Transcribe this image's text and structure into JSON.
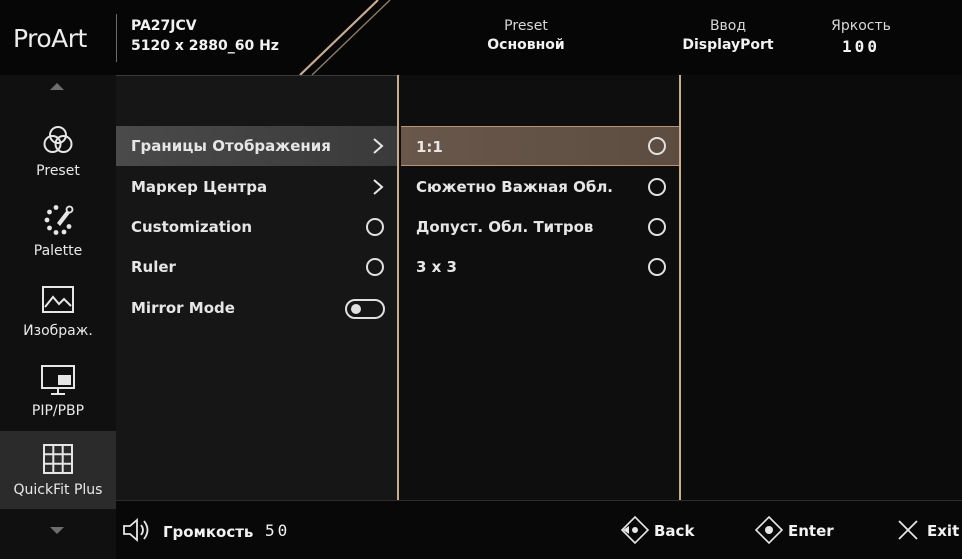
{
  "header": {
    "logo": "ProArt",
    "model": "PA27JCV",
    "resolution": "5120 x 2880_60 Hz",
    "preset_label": "Preset",
    "preset_value": "Основной",
    "input_label": "Ввод",
    "input_value": "DisplayPort",
    "brightness_label": "Яркость",
    "brightness_value": "100"
  },
  "sidebar": {
    "items": [
      {
        "label": "Preset",
        "icon": "preset-icon"
      },
      {
        "label": "Palette",
        "icon": "palette-icon"
      },
      {
        "label": "Изображ.",
        "icon": "image-icon"
      },
      {
        "label": "PIP/PBP",
        "icon": "pip-icon"
      },
      {
        "label": "QuickFit Plus",
        "icon": "grid-icon",
        "active": true
      }
    ]
  },
  "menu": {
    "items": [
      {
        "label": "Границы Отображения",
        "control": "chevron",
        "selected": true
      },
      {
        "label": "Маркер Центра",
        "control": "chevron"
      },
      {
        "label": "Customization",
        "control": "radio"
      },
      {
        "label": "Ruler",
        "control": "radio"
      },
      {
        "label": "Mirror Mode",
        "control": "toggle"
      }
    ]
  },
  "submenu": {
    "items": [
      {
        "label": "1:1",
        "selected": true
      },
      {
        "label": "Сюжетно Важная Обл.",
        "selected": false
      },
      {
        "label": "Допуст. Обл. Титров",
        "selected": false
      },
      {
        "label": "3 x 3",
        "selected": false
      }
    ]
  },
  "footer": {
    "volume_label": "Громкость",
    "volume_value": "50",
    "back_label": "Back",
    "enter_label": "Enter",
    "exit_label": "Exit"
  },
  "colors": {
    "accent": "#c9ad8a",
    "selected_row": "#4a4a4a",
    "selected_subrow": "#68574a"
  }
}
